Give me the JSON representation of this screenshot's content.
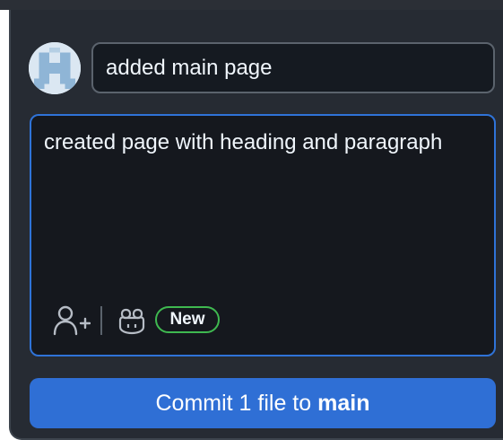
{
  "commit": {
    "summary_value": "added main page",
    "description_value": "created page with heading and paragraph",
    "badge_label": "New",
    "button_prefix": "Commit 1 file to",
    "branch": "main"
  },
  "icons": {
    "avatar": "identicon-avatar",
    "coauthor": "person-add-icon",
    "copilot": "copilot-icon"
  },
  "colors": {
    "panel_bg": "#262b33",
    "input_bg": "#151a21",
    "focus_border": "#2f73d8",
    "button_bg": "#2f6fd5",
    "badge_border": "#3fb950"
  }
}
